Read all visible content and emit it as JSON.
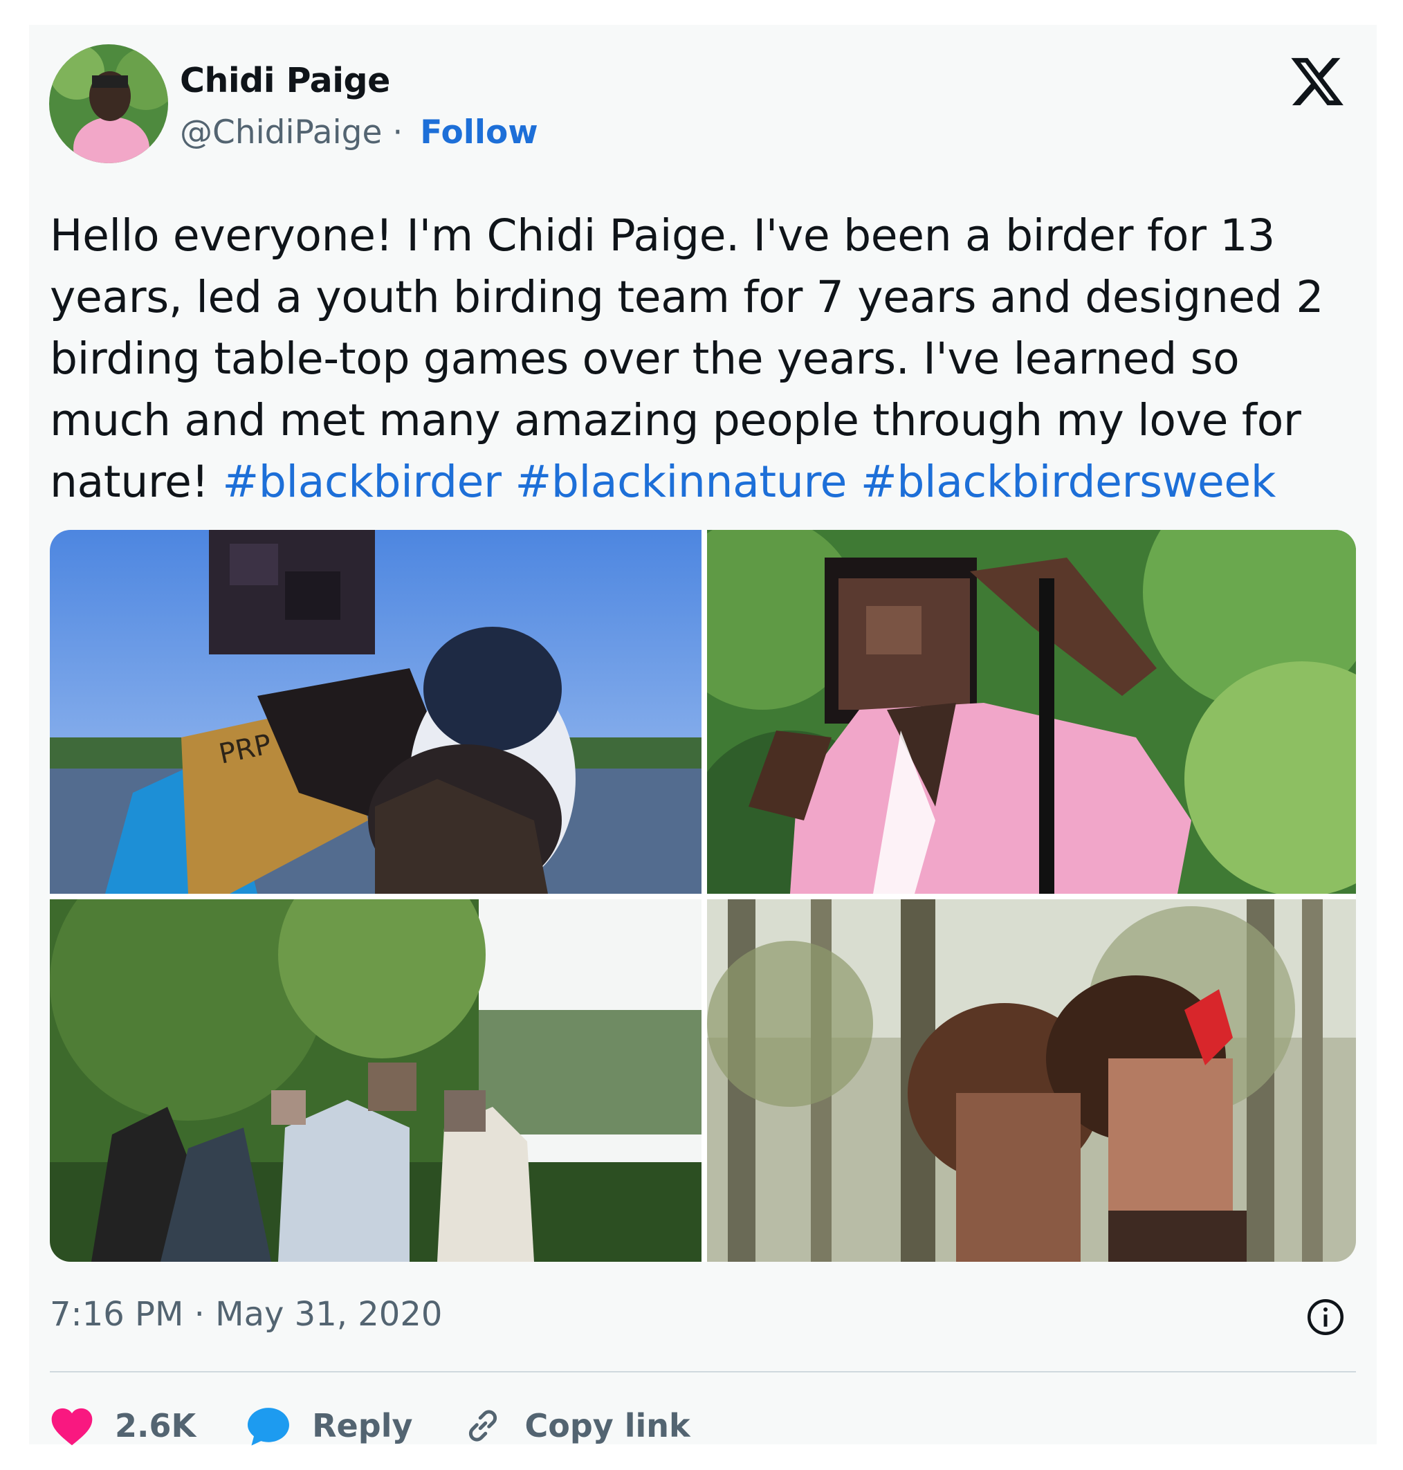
{
  "author": {
    "name": "Chidi Paige",
    "handle": "@ChidiPaige",
    "separator": "·",
    "follow_label": "Follow"
  },
  "platform_icon": "x-logo-icon",
  "tweet": {
    "text": "Hello everyone! I'm Chidi Paige. I've been a birder for 13 years, led a youth birding team for 7 years and designed 2 birding table-top games over the years. I've learned so much and met many amazing people through my love for nature!",
    "hashtags": [
      "#blackbirder",
      "#blackinnature",
      "#blackbirdersweek"
    ]
  },
  "media": {
    "photo1_patch_text": "PRP"
  },
  "timestamp": "7:16 PM · May 31, 2020",
  "actions": {
    "like_count": "2.6K",
    "reply_label": "Reply",
    "copy_link_label": "Copy link"
  },
  "colors": {
    "link": "#1d6fd8",
    "like": "#f91880",
    "reply_icon": "#1d9bf0",
    "text_primary": "#0f1419",
    "text_secondary": "#536471"
  },
  "icons": [
    "x-logo-icon",
    "info-icon",
    "heart-icon",
    "reply-bubble-icon",
    "link-icon"
  ]
}
